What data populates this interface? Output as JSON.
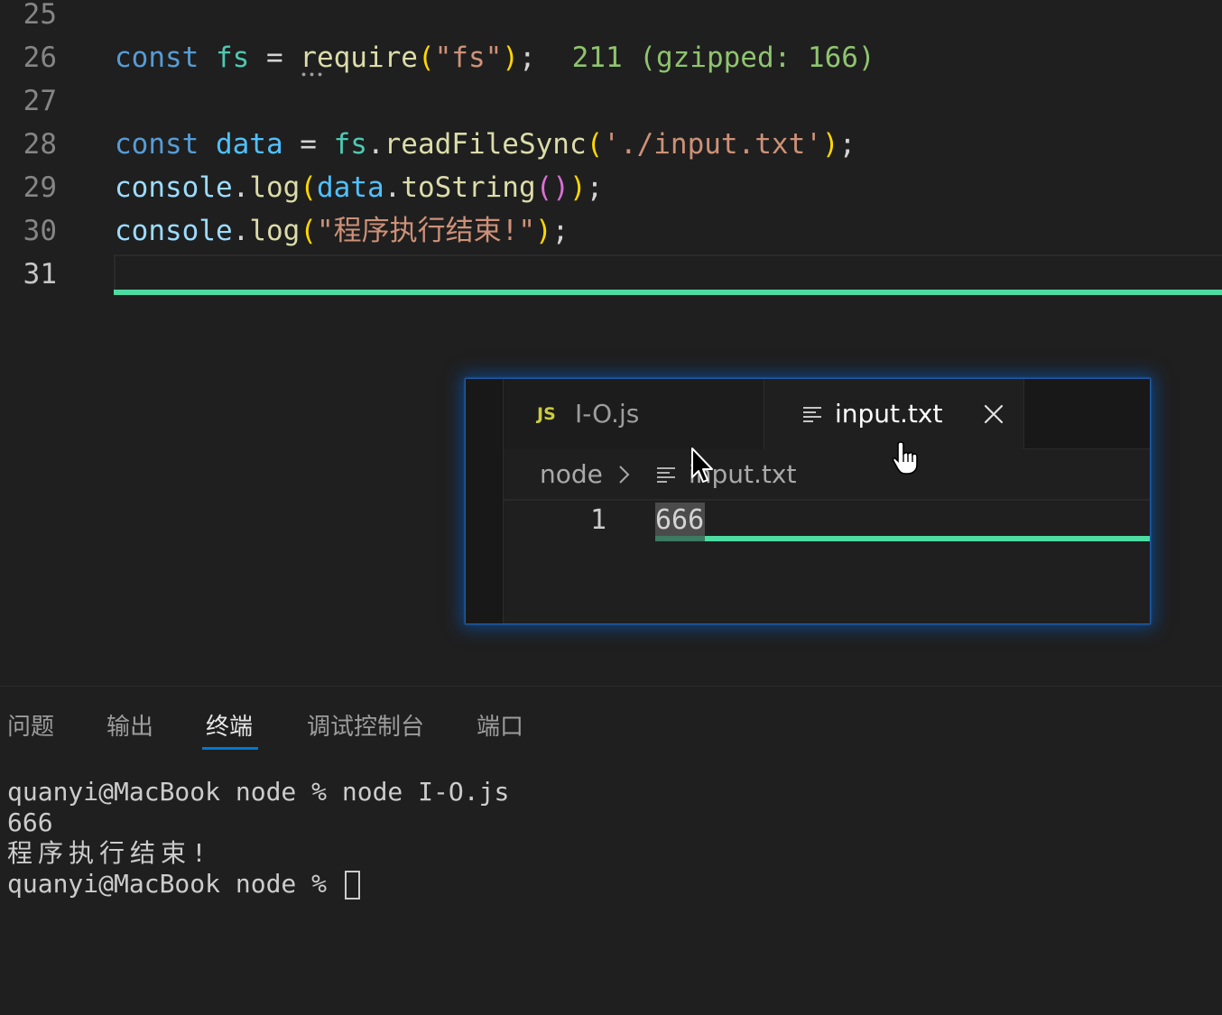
{
  "theme": {
    "accent": "#0078d4",
    "line_highlight_green": "#4cdca1",
    "line_highlight_green_dim": "#3c7a62",
    "hint_green": "#8fc46f"
  },
  "editor": {
    "lines": [
      {
        "number": "25",
        "tokens": []
      },
      {
        "number": "26",
        "tokens": [
          {
            "text": "const ",
            "color": "#569cd6"
          },
          {
            "text": "fs",
            "color": "#4ec9b0"
          },
          {
            "text": " = ",
            "color": "#d4d4d4"
          },
          {
            "text": "require",
            "color": "#dcdcaa"
          },
          {
            "text": "(",
            "color": "#ffd700"
          },
          {
            "text": "\"fs\"",
            "color": "#ce9178"
          },
          {
            "text": ")",
            "color": "#ffd700"
          },
          {
            "text": ";",
            "color": "#d4d4d4"
          }
        ],
        "hint": "211 (gzipped: 166)"
      },
      {
        "number": "27",
        "tokens": []
      },
      {
        "number": "28",
        "tokens": [
          {
            "text": "const ",
            "color": "#569cd6"
          },
          {
            "text": "data",
            "color": "#4fc1ff"
          },
          {
            "text": " = ",
            "color": "#d4d4d4"
          },
          {
            "text": "fs",
            "color": "#4ec9b0"
          },
          {
            "text": ".",
            "color": "#d4d4d4"
          },
          {
            "text": "readFileSync",
            "color": "#dcdcaa"
          },
          {
            "text": "(",
            "color": "#ffd700"
          },
          {
            "text": "'./input.txt'",
            "color": "#ce9178"
          },
          {
            "text": ")",
            "color": "#ffd700"
          },
          {
            "text": ";",
            "color": "#d4d4d4"
          }
        ]
      },
      {
        "number": "29",
        "tokens": [
          {
            "text": "console",
            "color": "#9cdcfe"
          },
          {
            "text": ".",
            "color": "#d4d4d4"
          },
          {
            "text": "log",
            "color": "#dcdcaa"
          },
          {
            "text": "(",
            "color": "#ffd700"
          },
          {
            "text": "data",
            "color": "#4fc1ff"
          },
          {
            "text": ".",
            "color": "#d4d4d4"
          },
          {
            "text": "toString",
            "color": "#dcdcaa"
          },
          {
            "text": "()",
            "color": "#da70d6"
          },
          {
            "text": ")",
            "color": "#ffd700"
          },
          {
            "text": ";",
            "color": "#d4d4d4"
          }
        ]
      },
      {
        "number": "30",
        "tokens": [
          {
            "text": "console",
            "color": "#9cdcfe"
          },
          {
            "text": ".",
            "color": "#d4d4d4"
          },
          {
            "text": "log",
            "color": "#dcdcaa"
          },
          {
            "text": "(",
            "color": "#ffd700"
          },
          {
            "text": "\"程序执行结束!\"",
            "color": "#ce9178"
          },
          {
            "text": ")",
            "color": "#ffd700"
          },
          {
            "text": ";",
            "color": "#d4d4d4"
          }
        ]
      },
      {
        "number": "31",
        "tokens": [],
        "current": true
      }
    ]
  },
  "drag_preview": {
    "tabs": [
      {
        "icon": "js-file-icon",
        "icon_label": "JS",
        "icon_color": "#cbcb41",
        "label": "I-O.js",
        "active": false
      },
      {
        "icon": "text-file-icon",
        "label": "input.txt",
        "active": true,
        "close_icon": "close-icon"
      }
    ],
    "breadcrumb": {
      "folder": "node",
      "separator_icon": "chevron-right-icon",
      "file_icon": "text-file-icon",
      "file": "input.txt"
    },
    "lines": [
      {
        "number": "1",
        "text": "666"
      }
    ]
  },
  "panel": {
    "tabs": [
      {
        "label": "问题",
        "active": false
      },
      {
        "label": "输出",
        "active": false
      },
      {
        "label": "终端",
        "active": true
      },
      {
        "label": "调试控制台",
        "active": false
      },
      {
        "label": "端口",
        "active": false
      }
    ],
    "terminal": {
      "lines": [
        "quanyi@MacBook node % node I-O.js",
        "666",
        "程序执行结束!",
        "quanyi@MacBook node % "
      ]
    }
  }
}
